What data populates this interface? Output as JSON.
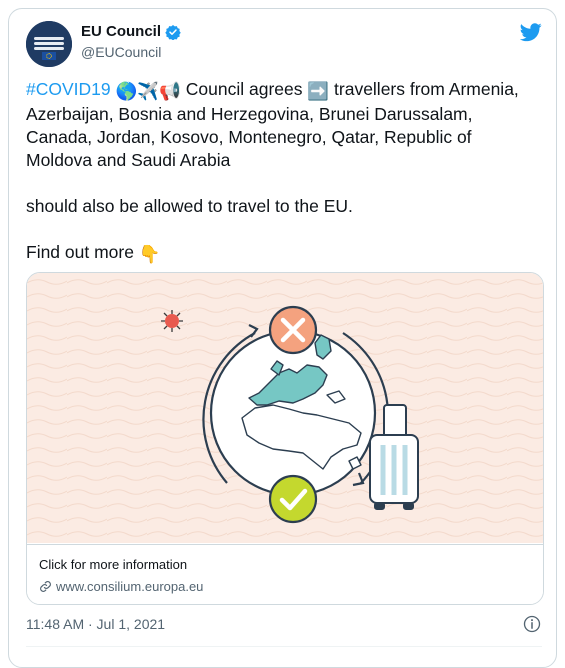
{
  "account": {
    "name": "EU Council",
    "handle": "@EUCouncil",
    "verified": true,
    "avatar_icon": "eu-council-logo"
  },
  "tweet": {
    "hashtag": "#COVID19",
    "line1_after_emojis": " Council agrees ",
    "line1_after_arrow": " travellers from Armenia, Azerbaijan, Bosnia and Herzegovina, Brunei Darussalam, Canada, Jordan, Kosovo, Montenegro, Qatar, Republic of Moldova and Saudi Arabia",
    "paragraph2": "should also be allowed to travel to the EU.",
    "paragraph3": "Find out more ",
    "emojis": {
      "globe": "🌎",
      "plane": "✈️",
      "megaphone": "📢",
      "arrow": "➡️",
      "pointing_down": "👇"
    }
  },
  "card": {
    "title": "Click for more information",
    "domain": "www.consilium.europa.eu",
    "illustration": "travel-restrictions-illustration"
  },
  "meta": {
    "timestamp": "11:48 AM · Jul 1, 2021"
  },
  "colors": {
    "accent": "#1d9bf0",
    "card_background": "#fbebe3",
    "cross_circle": "#f4a27f",
    "check_circle": "#c4d82e",
    "europe": "#76c7c4",
    "outline": "#2c3e50"
  }
}
